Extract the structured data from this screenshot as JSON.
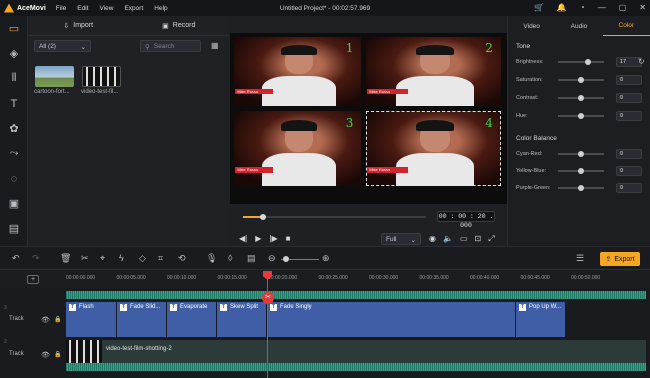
{
  "app": {
    "name": "AceMovi",
    "title": "Untitled Project* - 00:02:57.969"
  },
  "menu": [
    "File",
    "Edit",
    "View",
    "Export",
    "Help"
  ],
  "media": {
    "import": "Import",
    "record": "Record",
    "filter": "All (2)",
    "search_placeholder": "Search",
    "items": [
      {
        "name": "cartoon-fort..."
      },
      {
        "name": "video-test-fil..."
      }
    ]
  },
  "preview": {
    "cells": [
      "1",
      "2",
      "3",
      "4"
    ],
    "lower_third": "Mike Russo",
    "time": "00 : 00 : 20 . 000",
    "quality": "Full",
    "progress": 0.11
  },
  "props": {
    "tabs": [
      "Video",
      "Audio",
      "Color"
    ],
    "active_tab": "Color",
    "tone": "Tone",
    "balance": "Color Balance",
    "tone_rows": [
      {
        "label": "Brightness:",
        "value": "17",
        "pos": 0.65
      },
      {
        "label": "Saturation:",
        "value": "0",
        "pos": 0.5
      },
      {
        "label": "Contrast:",
        "value": "0",
        "pos": 0.5
      },
      {
        "label": "Hue:",
        "value": "0",
        "pos": 0.5
      }
    ],
    "balance_rows": [
      {
        "label": "Cyan-Red:",
        "value": "0",
        "pos": 0.5
      },
      {
        "label": "Yellow-Blue:",
        "value": "0",
        "pos": 0.5
      },
      {
        "label": "Purple-Green:",
        "value": "0",
        "pos": 0.5
      }
    ]
  },
  "export": "Export",
  "ruler": [
    "00:00:00.000",
    "00:00:05.000",
    "00:00:10.000",
    "00:00:15.000",
    "00:00:20.000",
    "00:00:25.000",
    "00:00:30.000",
    "00:00:35.000",
    "00:00:40.000",
    "00:00:45.000",
    "00:00:50.000"
  ],
  "timeline": {
    "track_label": "Track",
    "track_ids": [
      "3",
      "2"
    ],
    "text_clips": [
      "Flash",
      "Fade Slid...",
      "Evaporate",
      "Skew Split",
      "Fade Singly",
      "Pop Up W..."
    ],
    "video_clip": "video-test-film-shotting-2"
  },
  "colors": {
    "accent": "#f5a623",
    "clip": "#3f5ea5",
    "playhead": "#e23b3b"
  }
}
